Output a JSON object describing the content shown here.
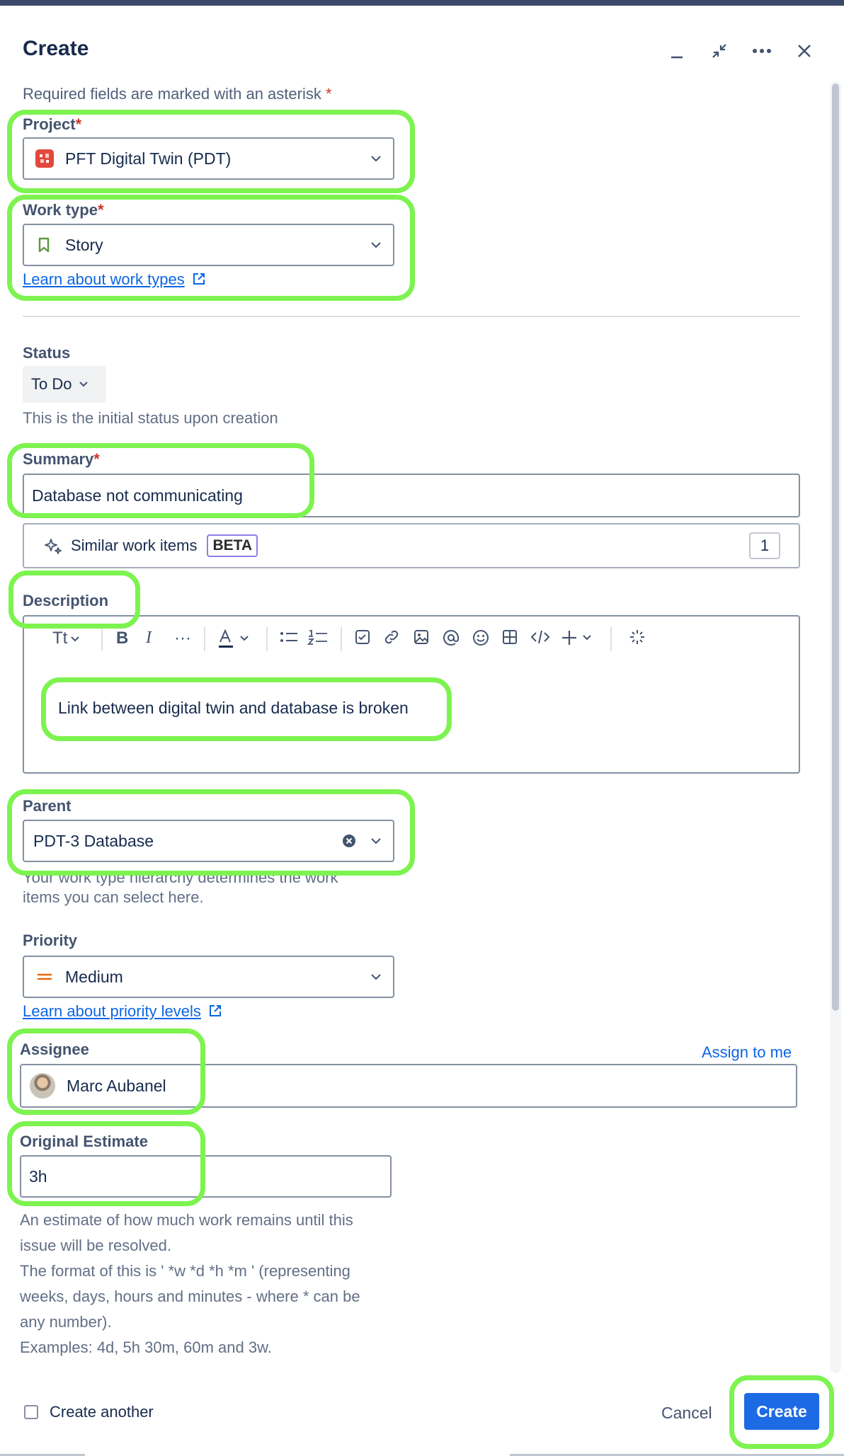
{
  "dialog": {
    "title": "Create",
    "required_note": "Required fields are marked with an asterisk",
    "asterisk": "*"
  },
  "project": {
    "label": "Project",
    "value": "PFT Digital Twin (PDT)"
  },
  "work_type": {
    "label": "Work type",
    "value": "Story",
    "learn_link": "Learn about work types"
  },
  "status": {
    "label": "Status",
    "value": "To Do",
    "help": "This is the initial status upon creation"
  },
  "summary": {
    "label": "Summary",
    "value": "Database not communicating"
  },
  "similar": {
    "label": "Similar work items",
    "badge": "BETA",
    "count": "1"
  },
  "description": {
    "label": "Description",
    "text": "Link between digital twin and database is broken",
    "toolbar": {
      "text_style": "Tt",
      "more": "···"
    }
  },
  "parent": {
    "label": "Parent",
    "value": "PDT-3 Database",
    "help_line1": "Your work type hierarchy determines the work",
    "help_line2": "items you can select here."
  },
  "priority": {
    "label": "Priority",
    "value": "Medium",
    "learn_link": "Learn about priority levels",
    "color": "#e56910"
  },
  "assignee": {
    "label": "Assignee",
    "value": "Marc Aubanel",
    "assign_to_me": "Assign to me"
  },
  "estimate": {
    "label": "Original Estimate",
    "value": "3h",
    "help": [
      "An estimate of how much work remains until this",
      "issue will be resolved.",
      "The format of this is ' *w *d *h *m ' (representing",
      "weeks, days, hours and minutes - where * can be",
      "any number).",
      "Examples: 4d, 5h 30m, 60m and 3w."
    ]
  },
  "footer": {
    "create_another": "Create another",
    "cancel": "Cancel",
    "create": "Create"
  },
  "colors": {
    "highlight": "#7df34f",
    "primary": "#1d6ae5",
    "link": "#0c66e4"
  }
}
